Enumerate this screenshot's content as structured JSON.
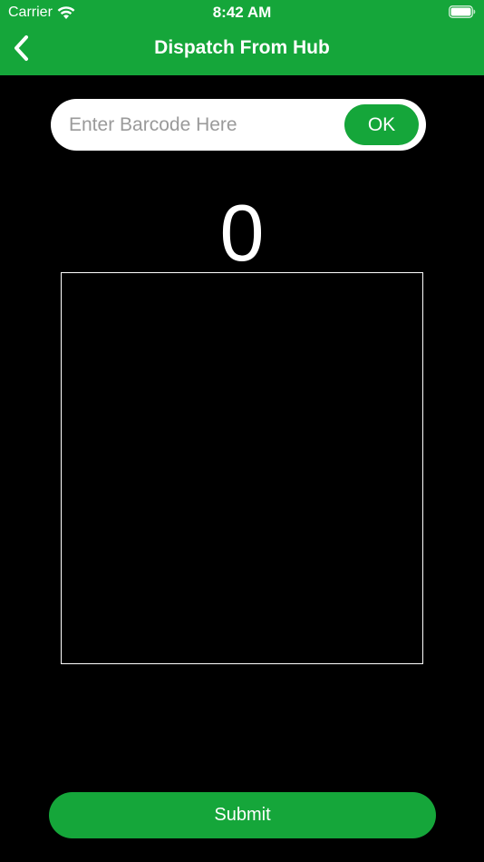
{
  "status_bar": {
    "carrier": "Carrier",
    "time": "8:42 AM",
    "icons": [
      "wifi-icon",
      "battery-icon"
    ]
  },
  "nav": {
    "title": "Dispatch From Hub",
    "back_icon": "chevron-left-icon"
  },
  "barcode": {
    "value": "",
    "placeholder": "Enter Barcode Here",
    "ok_label": "OK"
  },
  "scan_count": "0",
  "scanned_items": [],
  "footer": {
    "submit_label": "Submit"
  },
  "colors": {
    "accent": "#15A63A",
    "background": "#000000",
    "text_on_accent": "#FFFFFF",
    "placeholder": "#9A9A9A"
  }
}
